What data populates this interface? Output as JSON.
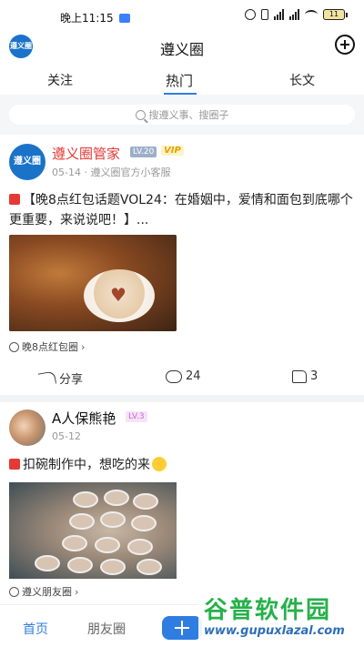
{
  "status_bar": {
    "time": "晚上11:15",
    "battery": "11"
  },
  "header": {
    "logo_text": "遵义圈",
    "title": "遵义圈"
  },
  "tabs": [
    {
      "label": "关注"
    },
    {
      "label": "热门"
    },
    {
      "label": "长文"
    }
  ],
  "search": {
    "placeholder": "搜遵义事、搜圈子"
  },
  "posts": [
    {
      "author": "遵义圈管家",
      "level": "LV.20",
      "vip": "VIP",
      "avatar_text": "遵义圈",
      "date": "05-14",
      "source": "遵义圈官方小客服",
      "content": "【晚8点红包话题VOL24：在婚姻中，爱情和面包到底哪个更重要，来说说吧！】...",
      "tag": "晚8点红包圈",
      "share_label": "分享",
      "comments": "24",
      "likes": "3"
    },
    {
      "author": "A人保熊艳",
      "level": "LV.3",
      "date": "05-12",
      "content": "扣碗制作中，想吃的来",
      "tag": "遵义朋友圈"
    }
  ],
  "bottom_nav": {
    "home": "首页",
    "friends": "朋友圈"
  },
  "watermark": {
    "main": "谷普软件园",
    "url": "www.gupuxlazal.com"
  },
  "colors": {
    "accent": "#2f7de1",
    "author_red": "#e53935",
    "watermark_green": "#26b14a"
  }
}
